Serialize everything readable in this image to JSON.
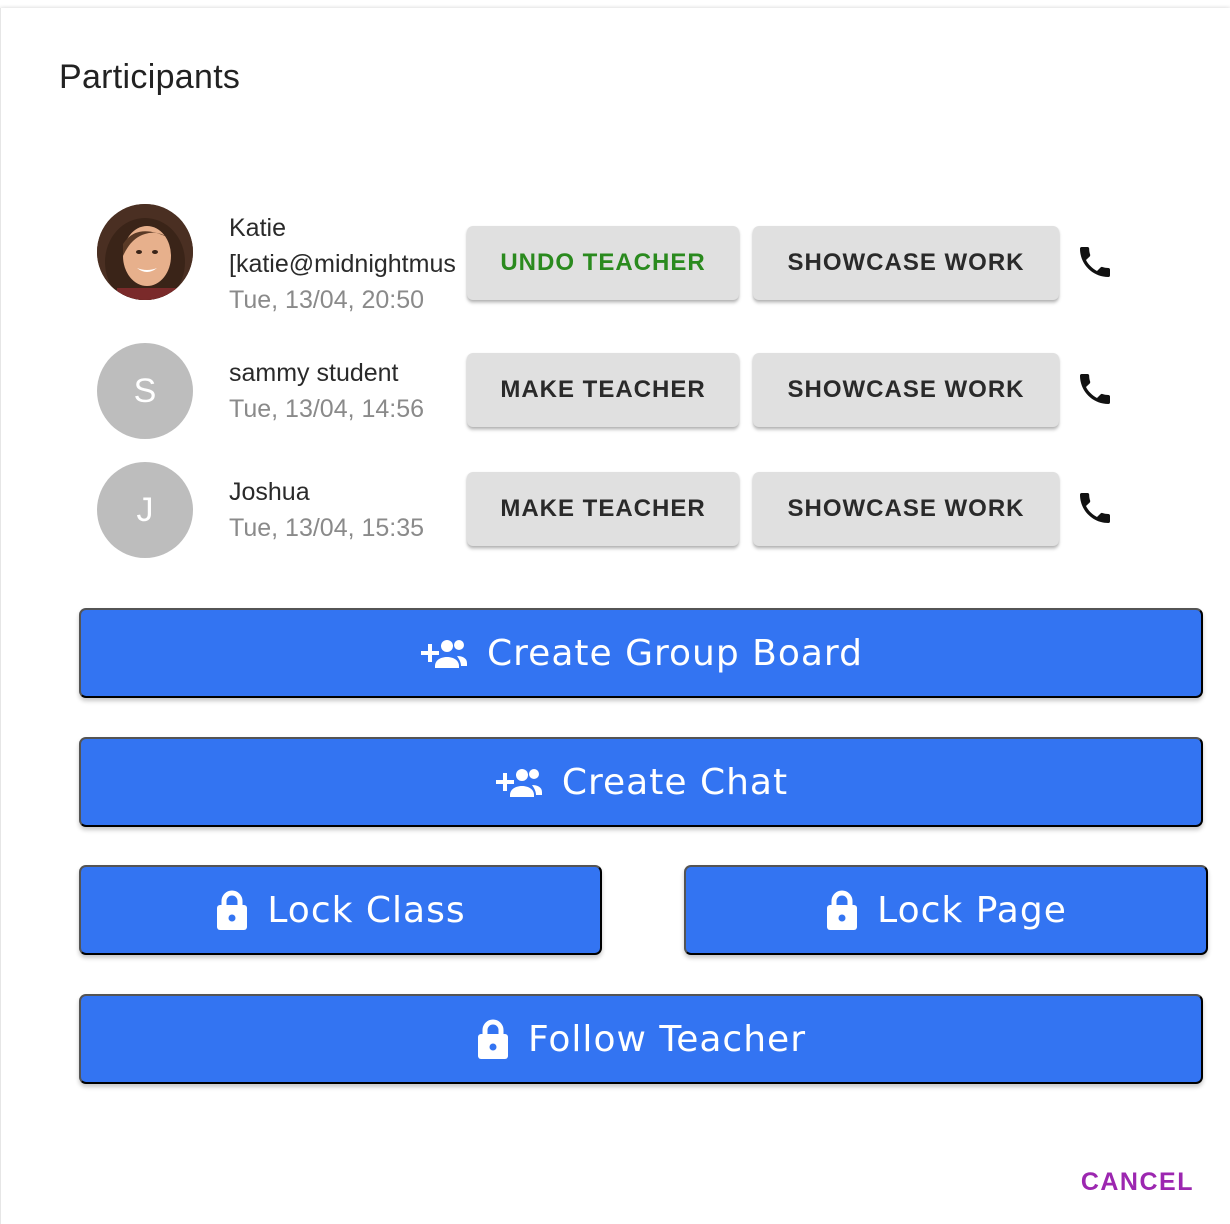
{
  "dialog": {
    "title": "Participants"
  },
  "participants": [
    {
      "name": "Katie",
      "email": "[katie@midnightmus",
      "time": "Tue, 13/04, 20:50",
      "initial": "",
      "teacher_label": "UNDO TEACHER",
      "showcase_label": "SHOWCASE WORK"
    },
    {
      "name": "sammy student",
      "email": "",
      "time": "Tue, 13/04, 14:56",
      "initial": "S",
      "teacher_label": "MAKE TEACHER",
      "showcase_label": "SHOWCASE WORK"
    },
    {
      "name": "Joshua",
      "email": "",
      "time": "Tue, 13/04, 15:35",
      "initial": "J",
      "teacher_label": "MAKE TEACHER",
      "showcase_label": "SHOWCASE WORK"
    }
  ],
  "actions": {
    "create_group_board": "Create Group Board",
    "create_chat": "Create Chat",
    "lock_class": "Lock Class",
    "lock_page": "Lock Page",
    "follow_teacher": "Follow Teacher"
  },
  "footer": {
    "cancel_label": "CANCEL"
  },
  "colors": {
    "primary": "#3374f2",
    "undo_teacher": "#2a8a1e",
    "cancel": "#9c27b0",
    "avatar_placeholder": "#bdbdbd"
  },
  "icons": {
    "row_action": "phone-icon",
    "group": "group-add-icon",
    "lock": "lock-icon"
  }
}
